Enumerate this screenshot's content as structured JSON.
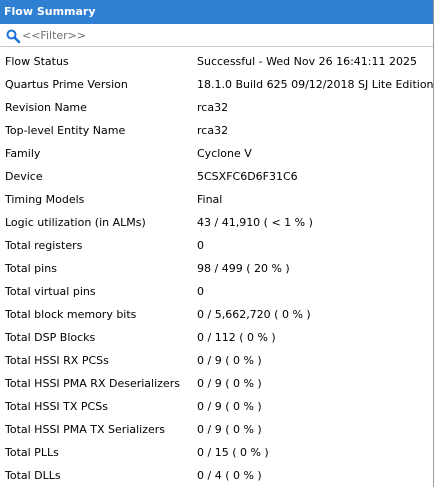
{
  "panel": {
    "title": "Flow Summary",
    "filter_placeholder": "<<Filter>>"
  },
  "rows": [
    {
      "label": "Flow Status",
      "value": "Successful - Wed Nov 26 16:41:11 2025"
    },
    {
      "label": "Quartus Prime Version",
      "value": "18.1.0 Build 625 09/12/2018 SJ Lite Edition"
    },
    {
      "label": "Revision Name",
      "value": "rca32"
    },
    {
      "label": "Top-level Entity Name",
      "value": "rca32"
    },
    {
      "label": "Family",
      "value": "Cyclone V"
    },
    {
      "label": "Device",
      "value": "5CSXFC6D6F31C6"
    },
    {
      "label": "Timing Models",
      "value": "Final"
    },
    {
      "label": "Logic utilization (in ALMs)",
      "value": "43 / 41,910 ( < 1 % )"
    },
    {
      "label": "Total registers",
      "value": "0"
    },
    {
      "label": "Total pins",
      "value": "98 / 499 ( 20 % )"
    },
    {
      "label": "Total virtual pins",
      "value": "0"
    },
    {
      "label": "Total block memory bits",
      "value": "0 / 5,662,720 ( 0 % )"
    },
    {
      "label": "Total DSP Blocks",
      "value": "0 / 112 ( 0 % )"
    },
    {
      "label": "Total HSSI RX PCSs",
      "value": "0 / 9 ( 0 % )"
    },
    {
      "label": "Total HSSI PMA RX Deserializers",
      "value": "0 / 9 ( 0 % )"
    },
    {
      "label": "Total HSSI TX PCSs",
      "value": "0 / 9 ( 0 % )"
    },
    {
      "label": "Total HSSI PMA TX Serializers",
      "value": "0 / 9 ( 0 % )"
    },
    {
      "label": "Total PLLs",
      "value": "0 / 15 ( 0 % )"
    },
    {
      "label": "Total DLLs",
      "value": "0 / 4 ( 0 % )"
    }
  ],
  "icons": {
    "filter": "search-icon"
  },
  "colors": {
    "title_bar": "#2f7fd3",
    "title_text": "#ffffff",
    "search_icon": "#1a73d9"
  }
}
